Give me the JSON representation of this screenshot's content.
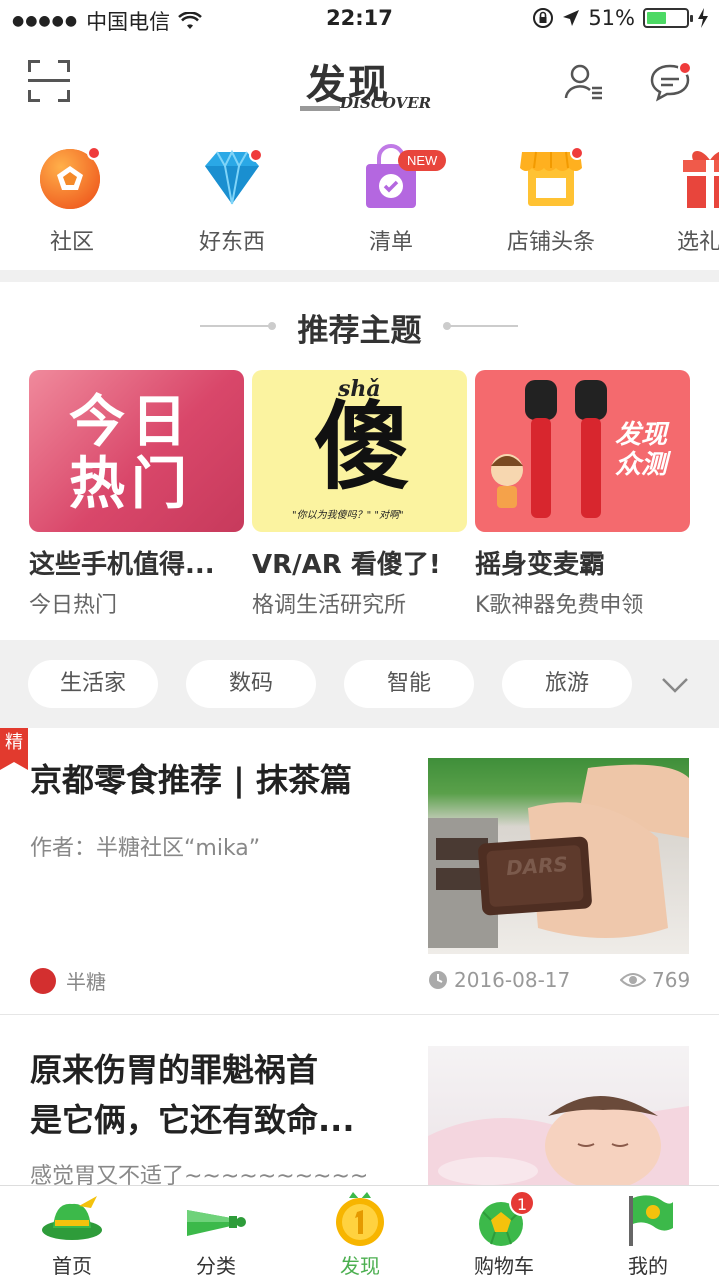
{
  "status_bar": {
    "carrier": "中国电信",
    "time": "22:17",
    "battery": "51%",
    "battery_level": 0.51
  },
  "header": {
    "logo_cn": "发现",
    "logo_en": "DISCOVER",
    "icons": [
      "scan-icon",
      "user-list-icon",
      "message-icon"
    ]
  },
  "categories": [
    {
      "label": "社区",
      "icon": "community-pentagon-icon",
      "dot": true
    },
    {
      "label": "好东西",
      "icon": "diamond-icon",
      "dot": true
    },
    {
      "label": "清单",
      "icon": "shopping-bag-check-icon",
      "badge": "NEW"
    },
    {
      "label": "店铺头条",
      "icon": "storefront-icon",
      "dot": true
    },
    {
      "label": "选礼神",
      "icon": "gift-icon"
    }
  ],
  "recommend": {
    "title": "推荐主题",
    "cards": [
      {
        "image_text": "今日热门",
        "title": "这些手机值得...",
        "subtitle": "今日热门"
      },
      {
        "image_text": "傻",
        "image_pinyin": "shǎ",
        "image_caption": "\"你以为我傻吗？\" \"对啊\"",
        "title": "VR/AR 看傻了!",
        "subtitle": "格调生活研究所"
      },
      {
        "image_text": "发现众测",
        "title": "摇身变麦霸",
        "subtitle": "K歌神器免费申领"
      }
    ]
  },
  "tags": [
    "生活家",
    "数码",
    "智能",
    "旅游"
  ],
  "articles": [
    {
      "badge": "精",
      "title": "京都零食推荐 | 抹茶篇",
      "author": "作者：半糖社区“mika”",
      "source": "半糖",
      "date": "2016-08-17",
      "views": "769",
      "image_label": "DARS"
    },
    {
      "title_line1": "原来伤胃的罪魁祸首",
      "title_line2": "是它俩，它还有致命...",
      "excerpt": "感觉胃又不适了~~~~~~~~~~"
    }
  ],
  "tabbar": [
    {
      "label": "首页",
      "icon": "home-hat-icon"
    },
    {
      "label": "分类",
      "icon": "horn-icon"
    },
    {
      "label": "发现",
      "icon": "medal-icon",
      "active": true
    },
    {
      "label": "购物车",
      "icon": "football-cart-icon",
      "count": "1"
    },
    {
      "label": "我的",
      "icon": "flag-icon"
    }
  ],
  "colors": {
    "accent_green": "#4caf50",
    "badge_red": "#e23a2e"
  }
}
